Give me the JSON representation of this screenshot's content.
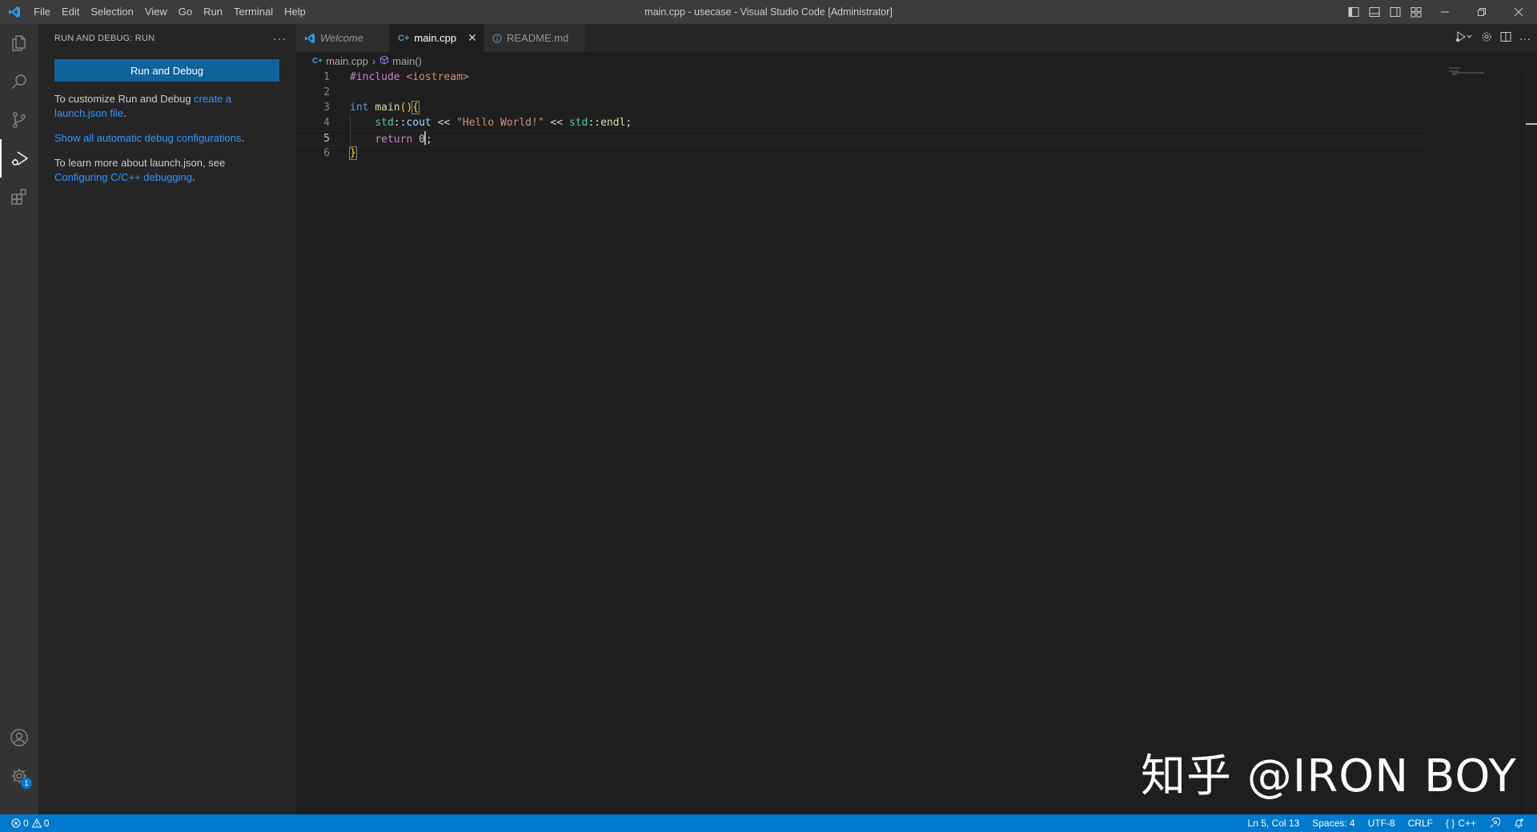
{
  "titlebar": {
    "menu": [
      "File",
      "Edit",
      "Selection",
      "View",
      "Go",
      "Run",
      "Terminal",
      "Help"
    ],
    "title": "main.cpp - usecase - Visual Studio Code [Administrator]"
  },
  "activitybar": {
    "items": [
      "explorer-icon",
      "search-icon",
      "source-control-icon",
      "run-debug-icon",
      "extensions-icon"
    ],
    "bottom": [
      "account-icon",
      "manage-gear-icon"
    ],
    "manage_badge": "1"
  },
  "sidebar": {
    "title": "RUN AND DEBUG: RUN",
    "more": "···",
    "run_button": "Run and Debug",
    "para1_text": "To customize Run and Debug ",
    "para1_link": "create a launch.json file",
    "para1_end": ".",
    "para2_link": "Show all automatic debug configurations",
    "para2_end": ".",
    "para3_text": "To learn more about launch.json, see ",
    "para3_link": "Configuring C/C++ debugging",
    "para3_end": "."
  },
  "tabs": [
    {
      "label": "Welcome",
      "italic": true,
      "active": false
    },
    {
      "label": "main.cpp",
      "active": true,
      "close": "✕"
    },
    {
      "label": "README.md",
      "active": false
    }
  ],
  "breadcrumb": {
    "file": "main.cpp",
    "symbol": "main()"
  },
  "editor": {
    "line_numbers": [
      "1",
      "2",
      "3",
      "4",
      "5",
      "6"
    ],
    "current_line": 5
  },
  "watermark": "知乎 @IRON BOY",
  "statusbar": {
    "errors": "0",
    "warnings": "0",
    "position": "Ln 5, Col 13",
    "spaces": "Spaces: 4",
    "encoding": "UTF-8",
    "eol": "CRLF",
    "language": "C++",
    "language_prefix": "{ }"
  },
  "colors": {
    "accent": "#007acc",
    "button": "#0e639c",
    "link": "#3794ff",
    "editor_bg": "#1e1e1e",
    "sidebar_bg": "#252526",
    "activitybar_bg": "#333333",
    "titlebar_bg": "#3c3c3c"
  }
}
